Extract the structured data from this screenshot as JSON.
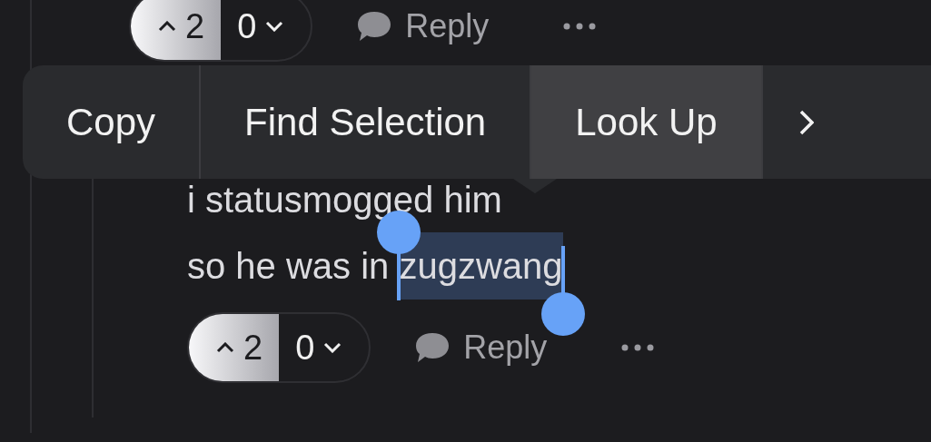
{
  "top_actions": {
    "upvotes": "2",
    "upvoted": true,
    "downvotes": "0",
    "downvoted": false,
    "reply": "Reply"
  },
  "context_menu": {
    "items": [
      {
        "kind": "text",
        "label": "Copy",
        "selected": false
      },
      {
        "kind": "text",
        "label": "Find Selection",
        "selected": false
      },
      {
        "kind": "text",
        "label": "Look Up",
        "selected": true
      },
      {
        "kind": "more",
        "selected": false
      }
    ]
  },
  "comment": {
    "lines": [
      "i statusmogged him",
      "so he was in "
    ],
    "selected_text": "zugzwang"
  },
  "bottom_actions": {
    "upvotes": "2",
    "upvoted": true,
    "downvotes": "0",
    "downvoted": false,
    "reply": "Reply"
  }
}
